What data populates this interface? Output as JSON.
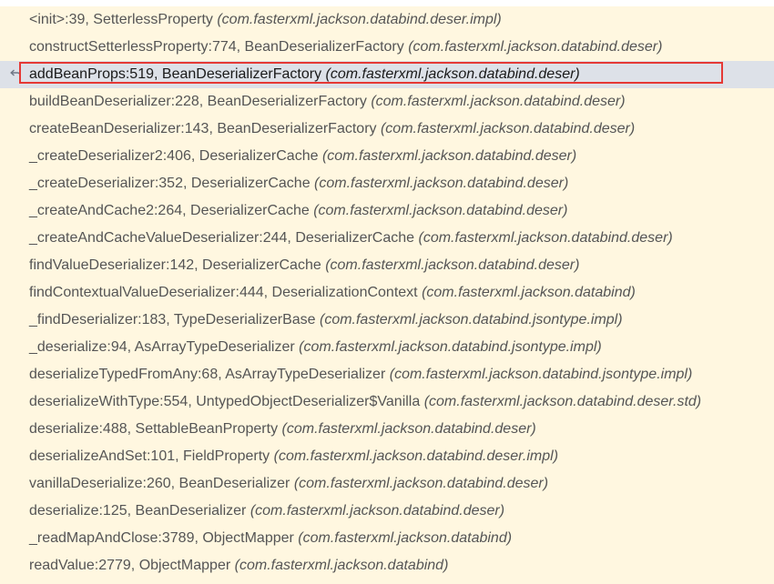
{
  "frames_panel": {
    "frames": [
      {
        "location": "<init>:39, SetterlessProperty",
        "package": "(com.fasterxml.jackson.databind.deser.impl)",
        "selected": false
      },
      {
        "location": "constructSetterlessProperty:774, BeanDeserializerFactory",
        "package": "(com.fasterxml.jackson.databind.deser)",
        "selected": false
      },
      {
        "location": "addBeanProps:519, BeanDeserializerFactory",
        "package": "(com.fasterxml.jackson.databind.deser)",
        "selected": true
      },
      {
        "location": "buildBeanDeserializer:228, BeanDeserializerFactory",
        "package": "(com.fasterxml.jackson.databind.deser)",
        "selected": false
      },
      {
        "location": "createBeanDeserializer:143, BeanDeserializerFactory",
        "package": "(com.fasterxml.jackson.databind.deser)",
        "selected": false
      },
      {
        "location": "_createDeserializer2:406, DeserializerCache",
        "package": "(com.fasterxml.jackson.databind.deser)",
        "selected": false
      },
      {
        "location": "_createDeserializer:352, DeserializerCache",
        "package": "(com.fasterxml.jackson.databind.deser)",
        "selected": false
      },
      {
        "location": "_createAndCache2:264, DeserializerCache",
        "package": "(com.fasterxml.jackson.databind.deser)",
        "selected": false
      },
      {
        "location": "_createAndCacheValueDeserializer:244, DeserializerCache",
        "package": "(com.fasterxml.jackson.databind.deser)",
        "selected": false
      },
      {
        "location": "findValueDeserializer:142, DeserializerCache",
        "package": "(com.fasterxml.jackson.databind.deser)",
        "selected": false
      },
      {
        "location": "findContextualValueDeserializer:444, DeserializationContext",
        "package": "(com.fasterxml.jackson.databind)",
        "selected": false
      },
      {
        "location": "_findDeserializer:183, TypeDeserializerBase",
        "package": "(com.fasterxml.jackson.databind.jsontype.impl)",
        "selected": false
      },
      {
        "location": "_deserialize:94, AsArrayTypeDeserializer",
        "package": "(com.fasterxml.jackson.databind.jsontype.impl)",
        "selected": false
      },
      {
        "location": "deserializeTypedFromAny:68, AsArrayTypeDeserializer",
        "package": "(com.fasterxml.jackson.databind.jsontype.impl)",
        "selected": false
      },
      {
        "location": "deserializeWithType:554, UntypedObjectDeserializer$Vanilla",
        "package": "(com.fasterxml.jackson.databind.deser.std)",
        "selected": false
      },
      {
        "location": "deserialize:488, SettableBeanProperty",
        "package": "(com.fasterxml.jackson.databind.deser)",
        "selected": false
      },
      {
        "location": "deserializeAndSet:101, FieldProperty",
        "package": "(com.fasterxml.jackson.databind.deser.impl)",
        "selected": false
      },
      {
        "location": "vanillaDeserialize:260, BeanDeserializer",
        "package": "(com.fasterxml.jackson.databind.deser)",
        "selected": false
      },
      {
        "location": "deserialize:125, BeanDeserializer",
        "package": "(com.fasterxml.jackson.databind.deser)",
        "selected": false
      },
      {
        "location": "_readMapAndClose:3789, ObjectMapper",
        "package": "(com.fasterxml.jackson.databind)",
        "selected": false
      },
      {
        "location": "readValue:2779, ObjectMapper",
        "package": "(com.fasterxml.jackson.databind)",
        "selected": false
      }
    ],
    "selected_icon": "return-arrow-icon",
    "colors": {
      "background": "#fff7e0",
      "selected_background": "#dde1e8",
      "highlight_border": "#e53935",
      "text": "#555555"
    }
  }
}
